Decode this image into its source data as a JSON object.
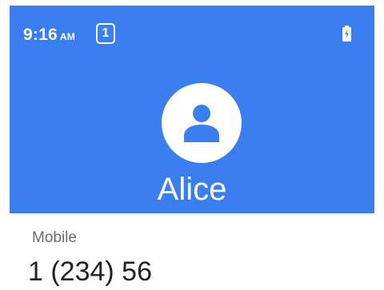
{
  "status_bar": {
    "time": "9:16",
    "ampm": "AM",
    "notification_count": "1",
    "battery_icon": "battery-icon"
  },
  "contact": {
    "avatar_icon": "person-icon",
    "name": "Alice"
  },
  "details": {
    "label": "Mobile",
    "value": "1 (234) 56"
  },
  "colors": {
    "header_bg": "#3a7ef0",
    "label_text": "#6b6b6b",
    "value_text": "#222222"
  }
}
